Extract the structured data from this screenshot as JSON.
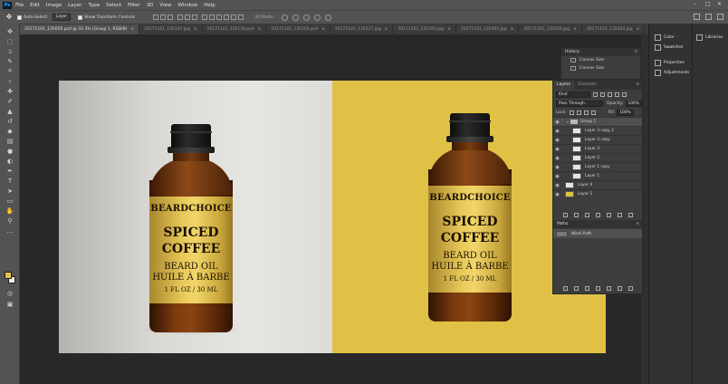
{
  "app": {
    "logo": "Ps",
    "menu": [
      "File",
      "Edit",
      "Image",
      "Layer",
      "Type",
      "Select",
      "Filter",
      "3D",
      "View",
      "Window",
      "Help"
    ],
    "window_controls": [
      "–",
      "□",
      "✕"
    ]
  },
  "options_bar": {
    "auto_select_label": "Auto-Select:",
    "auto_select_target": "Layer",
    "show_transform_label": "Show Transform Controls",
    "mode_3d_label": "3D Mode:"
  },
  "tabs": [
    {
      "label": "20171101_135050.psd @ 33.3% (Group 1, RGB/8)",
      "active": true
    },
    {
      "label": "20171101_135107.jpg",
      "active": false
    },
    {
      "label": "20171101_135138.psd",
      "active": false
    },
    {
      "label": "20171101_135202.psd",
      "active": false
    },
    {
      "label": "20171101_135227.jpg",
      "active": false
    },
    {
      "label": "20171101_135343.jpg",
      "active": false
    },
    {
      "label": "20171101_135405.jpg",
      "active": false
    },
    {
      "label": "20171101_135426.jpg",
      "active": false
    },
    {
      "label": "20171101_135454.jpg",
      "active": false
    },
    {
      "label": "20171101_135534.jpg",
      "active": false
    }
  ],
  "tools": [
    "move-icon",
    "marquee-icon",
    "lasso-icon",
    "quick-select-icon",
    "crop-icon",
    "eyedropper-icon",
    "healing-icon",
    "brush-icon",
    "stamp-icon",
    "history-brush-icon",
    "eraser-icon",
    "gradient-icon",
    "blur-icon",
    "dodge-icon",
    "pen-icon",
    "type-icon",
    "path-select-icon",
    "shape-icon",
    "hand-icon",
    "zoom-icon",
    "more-icon"
  ],
  "colors": {
    "foreground": "#e2c149",
    "background": "#f2efe6",
    "canvas_right_bg": "#e0c146"
  },
  "product": {
    "brand": "BEARDCHOICE",
    "name_line1": "SPICED",
    "name_line2": "COFFEE",
    "type_line1": "BEARD OIL",
    "type_line2": "HUILE À BARBE",
    "volume": "1 FL OZ / 30 ML"
  },
  "history": {
    "title": "History",
    "items": [
      {
        "label": "Canvas Size"
      },
      {
        "label": "Canvas Size"
      }
    ]
  },
  "layers": {
    "tabs": [
      "Layers",
      "Channels"
    ],
    "filter_kind": "Kind",
    "blend_mode": "Pass Through",
    "opacity_label": "Opacity:",
    "opacity_value": "100%",
    "lock_label": "Lock:",
    "fill_label": "Fill:",
    "fill_value": "100%",
    "rows": [
      {
        "name": "Group 1",
        "kind": "group",
        "selected": true,
        "indent": false
      },
      {
        "name": "Layer 3 copy 2",
        "kind": "layer",
        "selected": false,
        "indent": true
      },
      {
        "name": "Layer 3 copy",
        "kind": "layer",
        "selected": false,
        "indent": true
      },
      {
        "name": "Layer 3",
        "kind": "layer",
        "selected": false,
        "indent": true
      },
      {
        "name": "Layer 2",
        "kind": "layer",
        "selected": false,
        "indent": true
      },
      {
        "name": "Layer 1 copy",
        "kind": "layer",
        "selected": false,
        "indent": true
      },
      {
        "name": "Layer 1",
        "kind": "layer",
        "selected": false,
        "indent": true
      },
      {
        "name": "Layer 4",
        "kind": "layer",
        "selected": false,
        "indent": false
      },
      {
        "name": "Layer 5",
        "kind": "fill-yellow",
        "selected": false,
        "indent": false
      }
    ]
  },
  "paths": {
    "title": "Paths",
    "items": [
      {
        "name": "Work Path"
      }
    ]
  },
  "right_panels": {
    "items": [
      "Color",
      "Swatches",
      "Properties",
      "Adjustments"
    ],
    "libraries": "Libraries"
  }
}
